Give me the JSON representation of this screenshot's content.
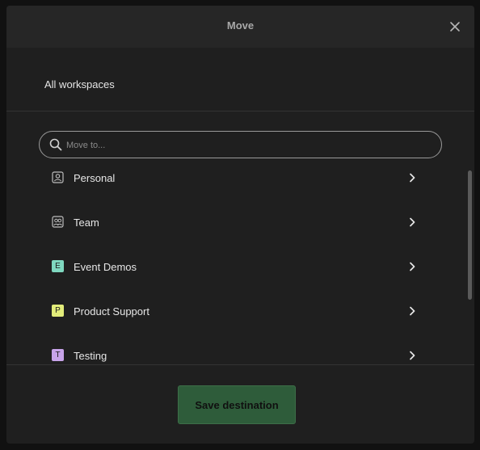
{
  "dialog": {
    "title": "Move",
    "close_icon": "close-icon"
  },
  "breadcrumb": {
    "label": "All workspaces"
  },
  "search": {
    "placeholder": "Move to...",
    "icon": "search-icon"
  },
  "workspaces": [
    {
      "label": "Personal",
      "icon": "person-icon"
    },
    {
      "label": "Team",
      "icon": "team-icon"
    },
    {
      "label": "Event Demos",
      "letter": "E",
      "color": "#7fd8c0"
    },
    {
      "label": "Product Support",
      "letter": "P",
      "color": "#e2ec7a"
    },
    {
      "label": "Testing",
      "letter": "T",
      "color": "#c8a4ea"
    }
  ],
  "footer": {
    "save_label": "Save destination"
  },
  "colors": {
    "modal_bg": "#1f1f1f",
    "header_bg": "#262626",
    "save_button_bg": "#2e5c3a"
  }
}
